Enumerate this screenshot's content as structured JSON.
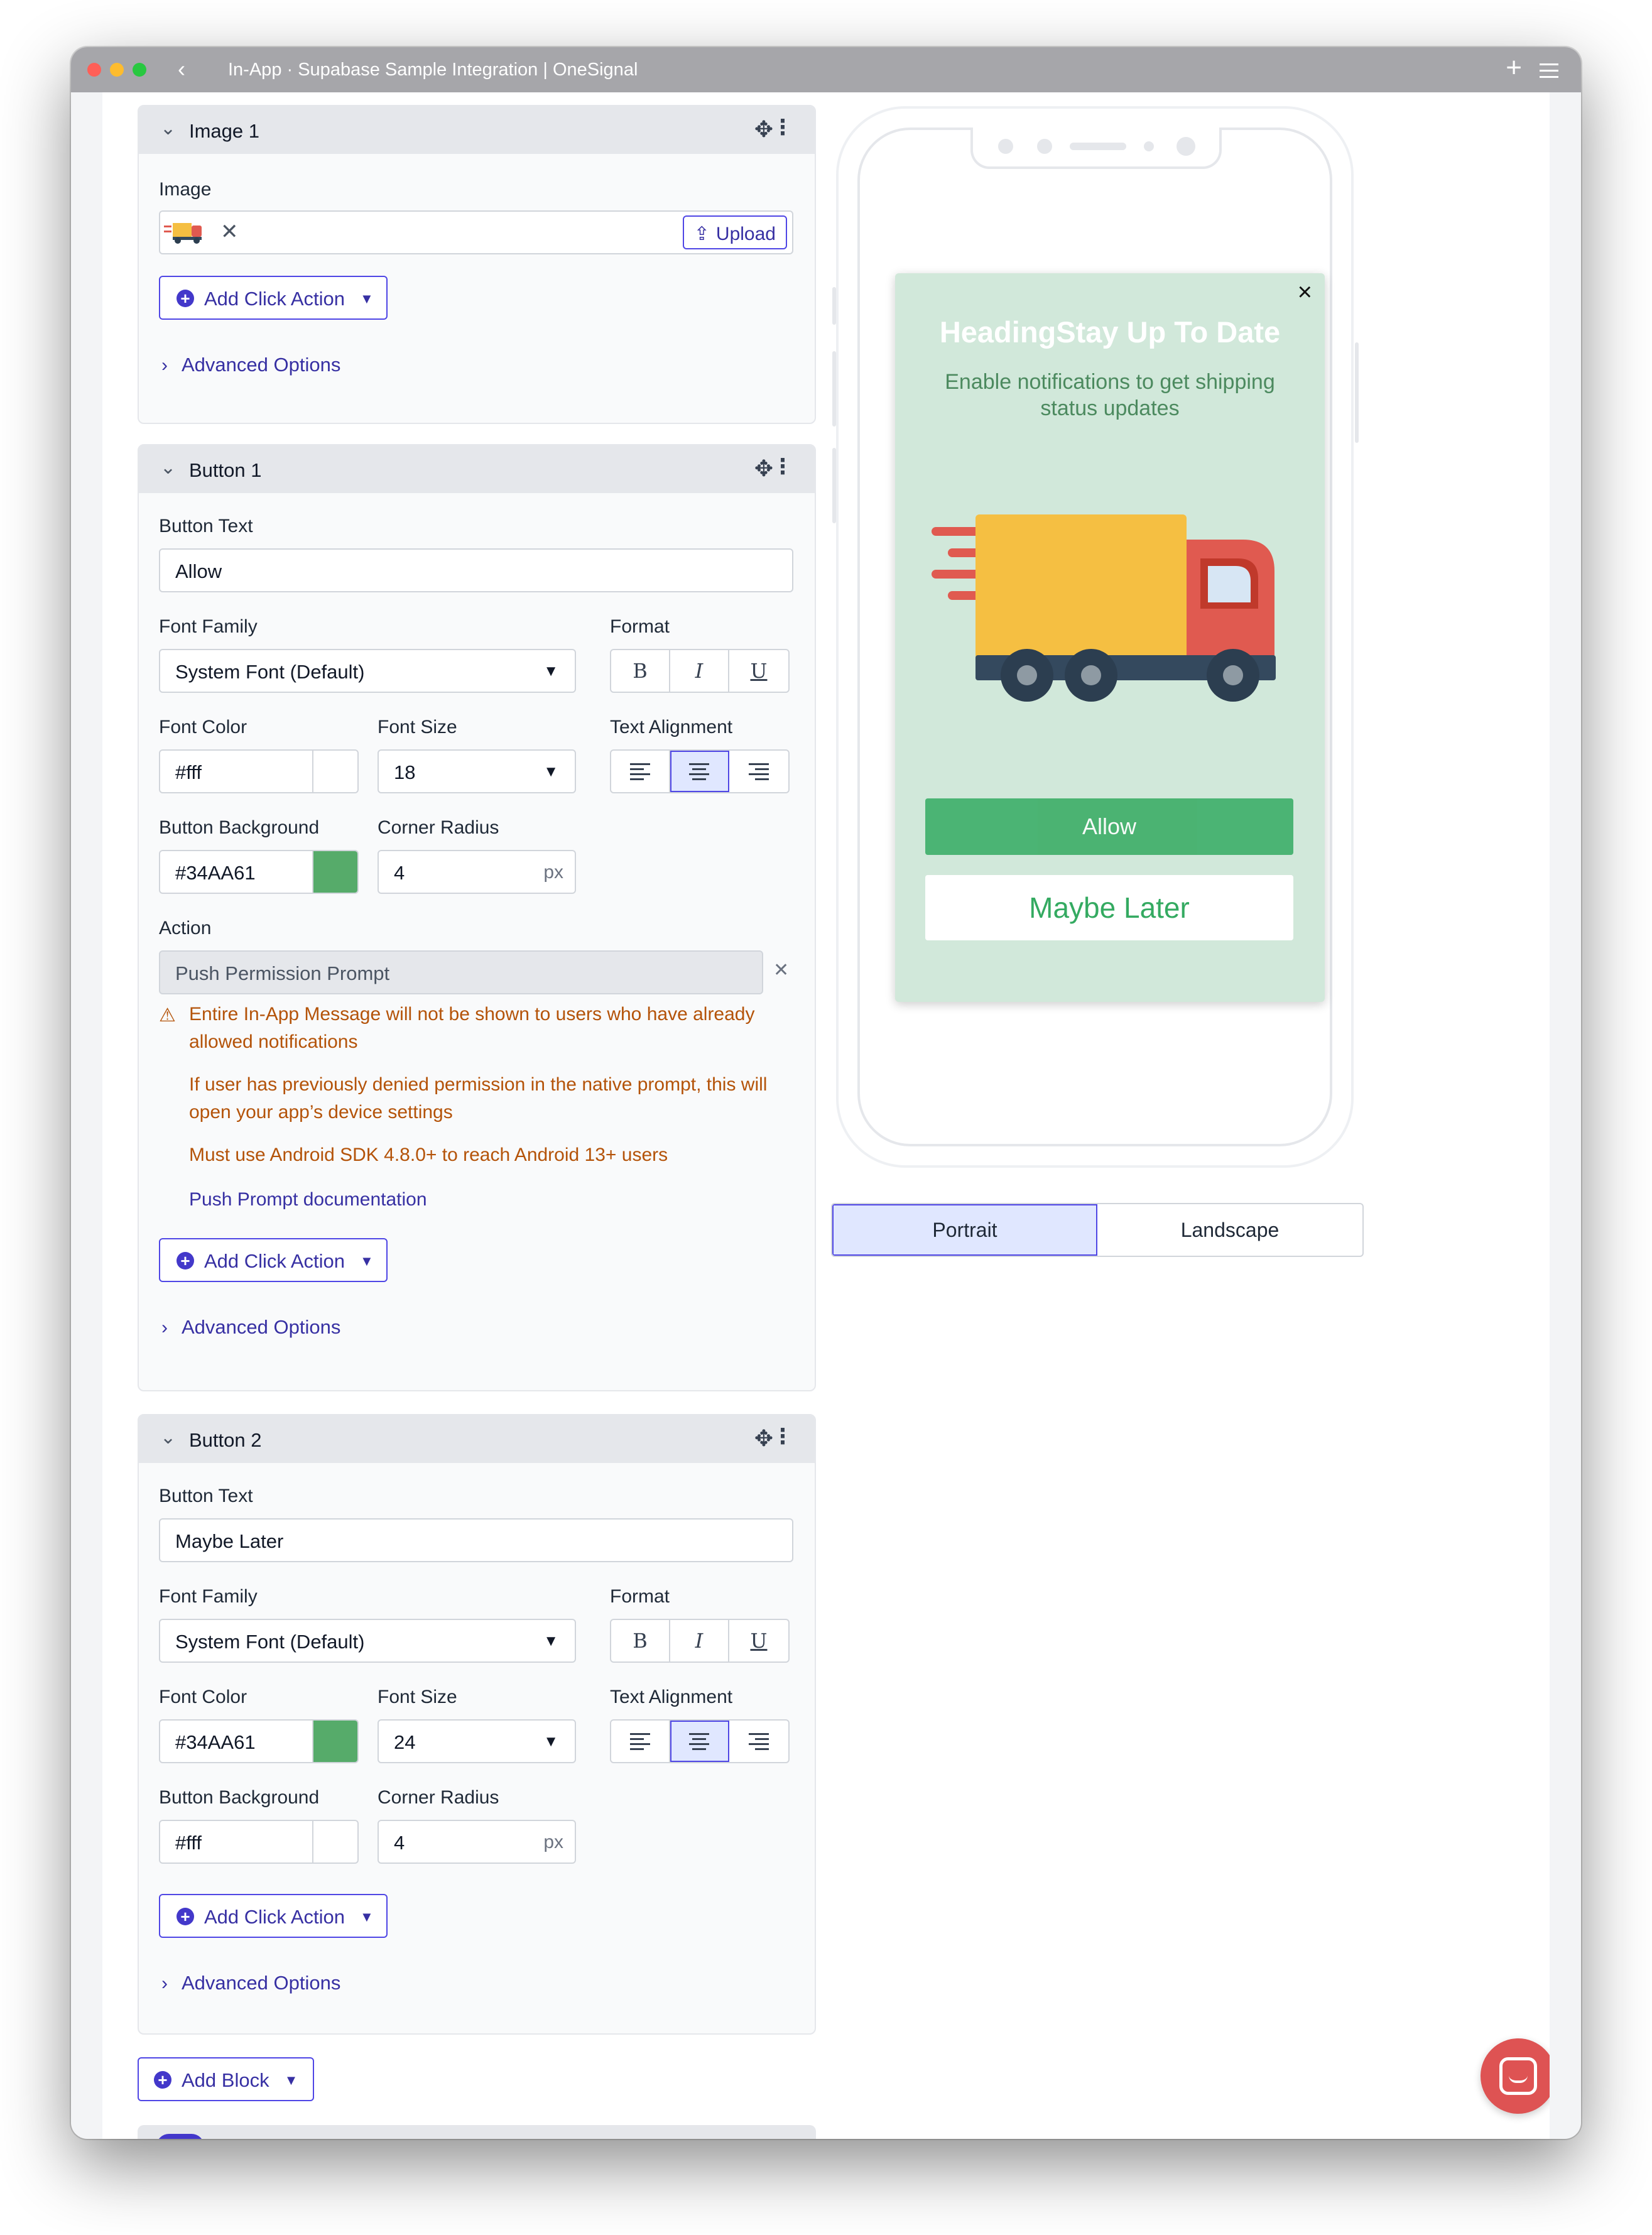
{
  "window": {
    "title": "In-App · Supabase Sample Integration | OneSignal"
  },
  "image_block": {
    "title": "Image 1",
    "image_label": "Image",
    "upload_label": "Upload",
    "add_click_action": "Add Click Action",
    "advanced_options": "Advanced Options"
  },
  "button1": {
    "title": "Button 1",
    "button_text_label": "Button Text",
    "button_text": "Allow",
    "font_family_label": "Font Family",
    "font_family": "System Font (Default)",
    "format_label": "Format",
    "font_color_label": "Font Color",
    "font_color": "#fff",
    "font_size_label": "Font Size",
    "font_size": "18",
    "text_alignment_label": "Text Alignment",
    "bg_label": "Button Background",
    "bg": "#34AA61",
    "radius_label": "Corner Radius",
    "radius": "4",
    "radius_unit": "px",
    "action_label": "Action",
    "action": "Push Permission Prompt",
    "warning1": "Entire In-App Message will not be shown to users who have already allowed notifications",
    "warning2": "If user has previously denied permission in the native prompt, this will open your app’s device settings",
    "warning3": "Must use Android SDK 4.8.0+ to reach Android 13+ users",
    "doc_link": "Push Prompt documentation",
    "add_click_action": "Add Click Action",
    "advanced_options": "Advanced Options"
  },
  "button2": {
    "title": "Button 2",
    "button_text_label": "Button Text",
    "button_text": "Maybe Later",
    "font_family_label": "Font Family",
    "font_family": "System Font (Default)",
    "format_label": "Format",
    "font_color_label": "Font Color",
    "font_color": "#34AA61",
    "font_size_label": "Font Size",
    "font_size": "24",
    "text_alignment_label": "Text Alignment",
    "bg_label": "Button Background",
    "bg": "#fff",
    "radius_label": "Corner Radius",
    "radius": "4",
    "radius_unit": "px",
    "add_click_action": "Add Click Action",
    "advanced_options": "Advanced Options"
  },
  "add_block": "Add Block",
  "preview": {
    "heading": "HeadingStay Up To Date",
    "body": "Enable notifications to get shipping status updates",
    "allow_button": "Allow",
    "maybe_button": "Maybe Later",
    "close": "×",
    "orientation_portrait": "Portrait",
    "orientation_landscape": "Landscape",
    "active_orientation": "Portrait"
  },
  "format_buttons": [
    "B",
    "I",
    "U"
  ],
  "colors": {
    "accent": "#4338ca",
    "green": "#34AA61",
    "warning": "#b45309",
    "message_bg": "#d1e8da"
  },
  "icons": [
    "back-icon",
    "plus-icon",
    "menu-icon",
    "chevron-down-icon",
    "move-icon",
    "kebab-icon",
    "close-icon",
    "upload-icon",
    "plus-circle-icon",
    "warning-icon",
    "chevron-right-icon",
    "chat-icon",
    "truck-icon"
  ]
}
